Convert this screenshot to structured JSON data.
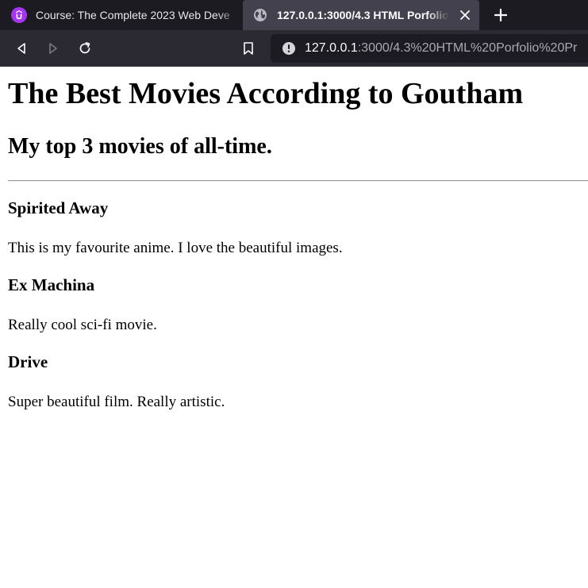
{
  "browser": {
    "tabs": [
      {
        "title": "Course: The Complete 2023 Web Deve",
        "favicon": "udemy-logo-icon",
        "active": false
      },
      {
        "title": "127.0.0.1:3000/4.3 HTML Porfolio",
        "favicon": "globe-icon",
        "active": true
      }
    ],
    "url_host": "127.0.0.1",
    "url_rest": ":3000/4.3%20HTML%20Porfolio%20Pr",
    "colors": {
      "tabbar": "#1c1b22",
      "active_tab": "#42414d",
      "navbar": "#2b2a33",
      "urlbar": "#1c1b22",
      "udemy_purple": "#a435f0"
    }
  },
  "page": {
    "heading": "The Best Movies According to Goutham",
    "subheading": "My top 3 movies of all-time.",
    "movies": [
      {
        "title": "Spirited Away",
        "description": "This is my favourite anime. I love the beautiful images."
      },
      {
        "title": "Ex Machina",
        "description": "Really cool sci-fi movie."
      },
      {
        "title": "Drive",
        "description": "Super beautiful film. Really artistic."
      }
    ]
  }
}
